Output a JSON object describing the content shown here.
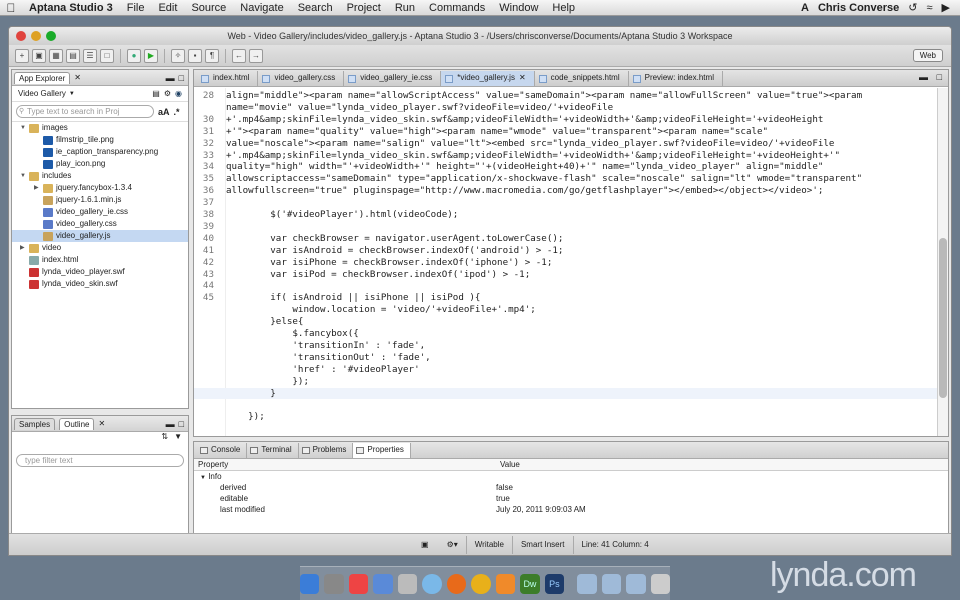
{
  "menubar": {
    "app": "Aptana Studio 3",
    "items": [
      "File",
      "Edit",
      "Source",
      "Navigate",
      "Search",
      "Project",
      "Run",
      "Commands",
      "Window",
      "Help"
    ],
    "user": "Chris Converse"
  },
  "window": {
    "title": "Web - Video Gallery/includes/video_gallery.js - Aptana Studio 3 - /Users/chrisconverse/Documents/Aptana Studio 3 Workspace",
    "perspective": "Web"
  },
  "app_explorer": {
    "tab": "App Explorer",
    "project": "Video Gallery",
    "search_placeholder": "Type text to search in Proj",
    "tree": [
      {
        "label": "images",
        "indent": 0,
        "type": "folder",
        "open": true
      },
      {
        "label": "filmstrip_tile.png",
        "indent": 1,
        "type": "ps"
      },
      {
        "label": "ie_caption_transparency.png",
        "indent": 1,
        "type": "ps"
      },
      {
        "label": "play_icon.png",
        "indent": 1,
        "type": "ps"
      },
      {
        "label": "includes",
        "indent": 0,
        "type": "folder",
        "open": true
      },
      {
        "label": "jquery.fancybox-1.3.4",
        "indent": 1,
        "type": "folder",
        "open": false
      },
      {
        "label": "jquery-1.6.1.min.js",
        "indent": 1,
        "type": "js"
      },
      {
        "label": "video_gallery_ie.css",
        "indent": 1,
        "type": "css"
      },
      {
        "label": "video_gallery.css",
        "indent": 1,
        "type": "css"
      },
      {
        "label": "video_gallery.js",
        "indent": 1,
        "type": "js",
        "selected": true
      },
      {
        "label": "video",
        "indent": 0,
        "type": "folder",
        "open": false
      },
      {
        "label": "index.html",
        "indent": 0,
        "type": "html"
      },
      {
        "label": "lynda_video_player.swf",
        "indent": 0,
        "type": "swf"
      },
      {
        "label": "lynda_video_skin.swf",
        "indent": 0,
        "type": "swf"
      }
    ]
  },
  "outline": {
    "tabs": [
      "Samples",
      "Outline"
    ],
    "filter_placeholder": "type filter text"
  },
  "editor": {
    "tabs": [
      {
        "label": "index.html",
        "active": false
      },
      {
        "label": "video_gallery.css",
        "active": false
      },
      {
        "label": "video_gallery_ie.css",
        "active": false
      },
      {
        "label": "*video_gallery.js",
        "active": true
      },
      {
        "label": "code_snippets.html",
        "active": false
      },
      {
        "label": "Preview: index.html",
        "active": false
      }
    ],
    "lines": [
      {
        "n": "28",
        "t": "align=\"middle\"><param name=\"allowScriptAccess\" value=\"sameDomain\"><param name=\"allowFullScreen\" value=\"true\"><param"
      },
      {
        "n": "",
        "t": "name=\"movie\" value=\"lynda_video_player.swf?videoFile=video/'+videoFile"
      },
      {
        "n": "30",
        "t": "+'.mp4&amp;skinFile=lynda_video_skin.swf&amp;videoFileWidth='+videoWidth+'&amp;videoFileHeight='+videoHeight"
      },
      {
        "n": "31",
        "t": "+'\"><param name=\"quality\" value=\"high\"><param name=\"wmode\" value=\"transparent\"><param name=\"scale\""
      },
      {
        "n": "32",
        "t": "value=\"noscale\"><param name=\"salign\" value=\"lt\"><embed src=\"lynda_video_player.swf?videoFile=video/'+videoFile"
      },
      {
        "n": "33",
        "t": "+'.mp4&amp;skinFile=lynda_video_skin.swf&amp;videoFileWidth='+videoWidth+'&amp;videoFileHeight='+videoHeight+'\""
      },
      {
        "n": "34",
        "t": "quality=\"high\" width=\"'+videoWidth+'\" height=\"'+(videoHeight+40)+'\" name=\"lynda_video_player\" align=\"middle\""
      },
      {
        "n": "35",
        "t": "allowscriptaccess=\"sameDomain\" type=\"application/x-shockwave-flash\" scale=\"noscale\" salign=\"lt\" wmode=\"transparent\""
      },
      {
        "n": "36",
        "t": "allowfullscreen=\"true\" pluginspage=\"http://www.macromedia.com/go/getflashplayer\"></embed></object></video>';"
      },
      {
        "n": "37",
        "t": ""
      },
      {
        "n": "38",
        "t": "        $('#videoPlayer').html(videoCode);"
      },
      {
        "n": "39",
        "t": ""
      },
      {
        "n": "40",
        "t": "        var checkBrowser = navigator.userAgent.toLowerCase();"
      },
      {
        "n": "41",
        "t": "        var isAndroid = checkBrowser.indexOf('android') > -1;"
      },
      {
        "n": "42",
        "t": "        var isiPhone = checkBrowser.indexOf('iphone') > -1;"
      },
      {
        "n": "43",
        "t": "        var isiPod = checkBrowser.indexOf('ipod') > -1;"
      },
      {
        "n": "44",
        "t": ""
      },
      {
        "n": "45",
        "t": "        if( isAndroid || isiPhone || isiPod ){"
      },
      {
        "n": "",
        "t": "            window.location = 'video/'+videoFile+'.mp4';"
      },
      {
        "n": "",
        "t": "        }else{"
      },
      {
        "n": "",
        "t": "            $.fancybox({"
      },
      {
        "n": "",
        "t": "            'transitionIn' : 'fade',"
      },
      {
        "n": "",
        "t": "            'transitionOut' : 'fade',"
      },
      {
        "n": "",
        "t": "            'href' : '#videoPlayer'"
      },
      {
        "n": "",
        "t": "            });"
      },
      {
        "n": "",
        "t": "        }"
      },
      {
        "n": "",
        "t": ""
      },
      {
        "n": "",
        "t": "    });"
      }
    ]
  },
  "bottom": {
    "tabs": [
      {
        "label": "Console",
        "active": false
      },
      {
        "label": "Terminal",
        "active": false
      },
      {
        "label": "Problems",
        "active": false
      },
      {
        "label": "Properties",
        "active": true
      }
    ],
    "columns": [
      "Property",
      "Value"
    ],
    "group": "Info",
    "rows": [
      {
        "k": "derived",
        "v": "false"
      },
      {
        "k": "editable",
        "v": "true"
      },
      {
        "k": "last modified",
        "v": "July 20, 2011 9:09:03 AM"
      }
    ]
  },
  "status": {
    "mode": "Writable",
    "insert": "Smart Insert",
    "position": "Line: 41 Column: 4"
  },
  "watermark": "lynda.com"
}
